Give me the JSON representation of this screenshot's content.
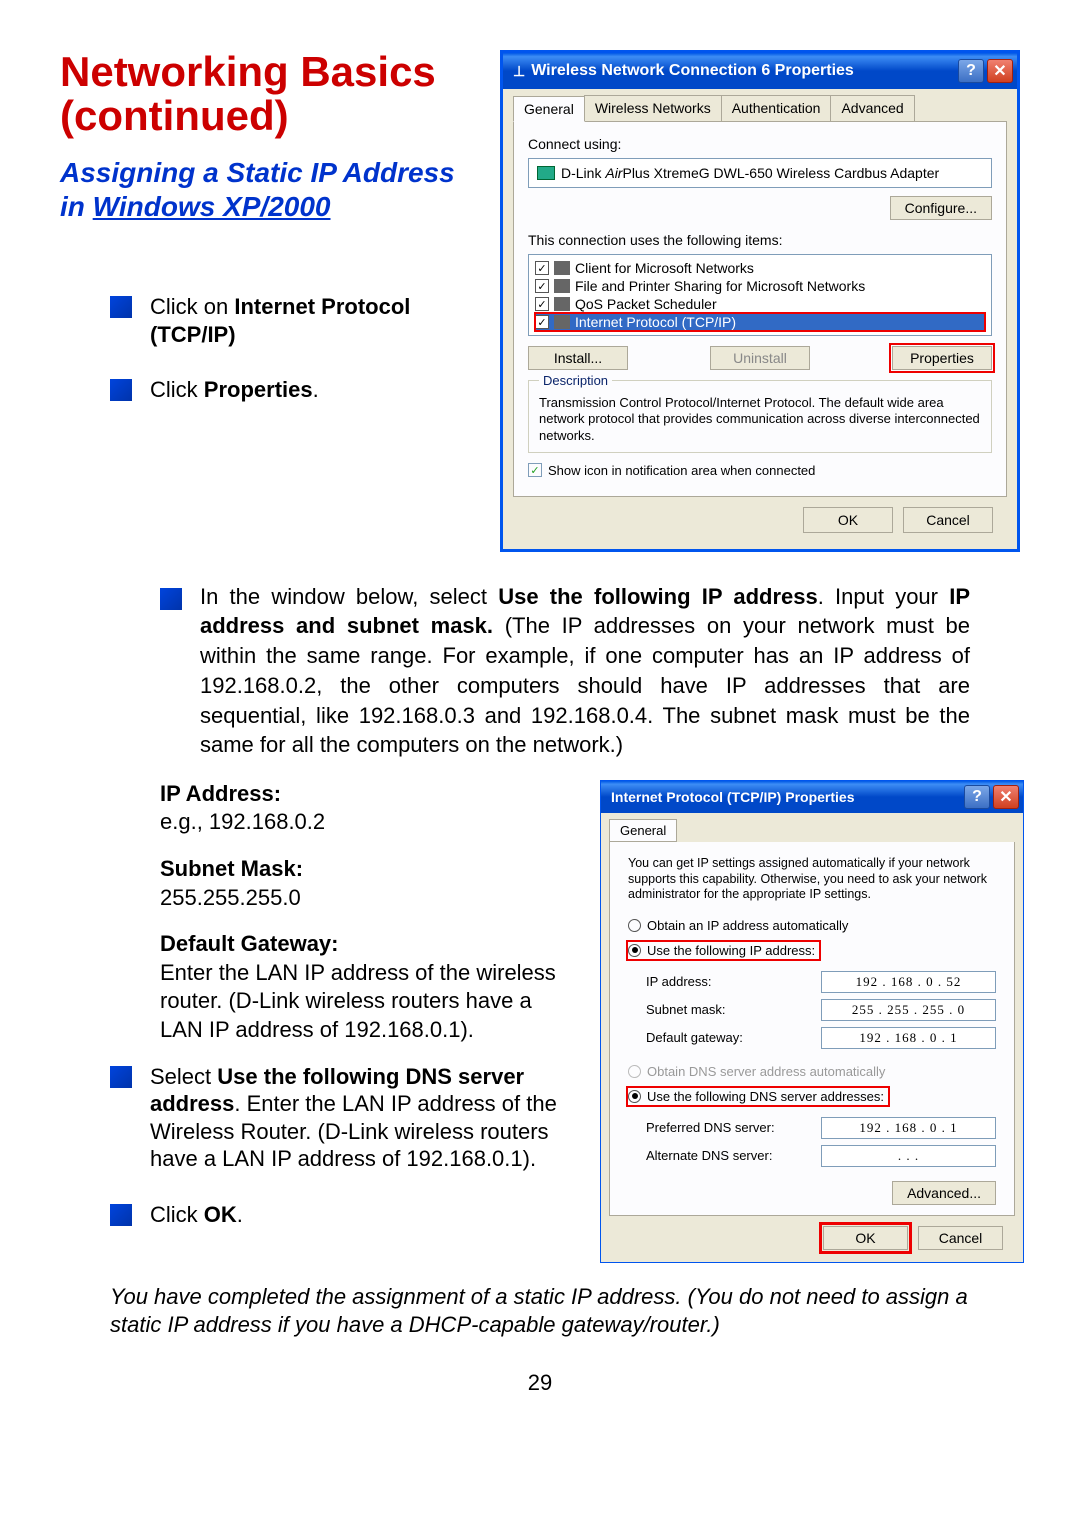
{
  "heading": "Networking Basics (continued)",
  "subheading": {
    "line1": "Assigning a Static IP Address",
    "line2_prefix": "in ",
    "line2_underlined": "Windows XP/2000"
  },
  "left_bullets": [
    {
      "pre": "Click on ",
      "bold": "Internet Protocol (TCP/IP)",
      "post": ""
    },
    {
      "pre": "Click ",
      "bold": "Properties",
      "post": "."
    }
  ],
  "dialog1": {
    "title": "Wireless Network Connection 6 Properties",
    "tabs": [
      "General",
      "Wireless Networks",
      "Authentication",
      "Advanced"
    ],
    "connect_using_label": "Connect using:",
    "adapter": "D-Link AirPlus XtremeG DWL-650 Wireless Cardbus Adapter",
    "configure_btn": "Configure...",
    "items_label": "This connection uses the following items:",
    "items": [
      {
        "label": "Client for Microsoft Networks",
        "checked": true,
        "selected": false
      },
      {
        "label": "File and Printer Sharing for Microsoft Networks",
        "checked": true,
        "selected": false
      },
      {
        "label": "QoS Packet Scheduler",
        "checked": true,
        "selected": false
      },
      {
        "label": "Internet Protocol (TCP/IP)",
        "checked": true,
        "selected": true
      }
    ],
    "install_btn": "Install...",
    "uninstall_btn": "Uninstall",
    "properties_btn": "Properties",
    "description_legend": "Description",
    "description_text": "Transmission Control Protocol/Internet Protocol. The default wide area network protocol that provides communication across diverse interconnected networks.",
    "show_icon_label": "Show icon in notification area when connected",
    "ok_btn": "OK",
    "cancel_btn": "Cancel"
  },
  "middle_bullet": {
    "parts": [
      {
        "t": "In the window below, select ",
        "b": false
      },
      {
        "t": "Use the following IP address",
        "b": true
      },
      {
        "t": ". Input your ",
        "b": false
      },
      {
        "t": "IP address and subnet mask.",
        "b": true
      },
      {
        "t": " (The IP addresses on your network must be within the same range. For example, if one computer has an IP address of 192.168.0.2, the other computers should have IP addresses that are sequential, like 192.168.0.3 and 192.168.0.4. The subnet mask must be the same for all the computers on the network.)",
        "b": false
      }
    ]
  },
  "definitions": {
    "ip_addr_label": "IP Address:",
    "ip_addr_val": "e.g., 192.168.0.2",
    "subnet_label": "Subnet Mask:",
    "subnet_val": "255.255.255.0",
    "gateway_label": "Default Gateway:",
    "gateway_val": "Enter the LAN IP address of the wireless router. (D-Link wireless routers have a LAN IP address of 192.168.0.1)."
  },
  "lower_bullets": [
    {
      "parts": [
        {
          "t": "Select ",
          "b": false
        },
        {
          "t": "Use the following DNS server address",
          "b": true
        },
        {
          "t": ". Enter the LAN IP address of the Wireless Router. (D-Link wireless routers have a LAN IP address of 192.168.0.1).",
          "b": false
        }
      ]
    },
    {
      "parts": [
        {
          "t": "Click ",
          "b": false
        },
        {
          "t": "OK",
          "b": true
        },
        {
          "t": ".",
          "b": false
        }
      ]
    }
  ],
  "dialog2": {
    "title": "Internet Protocol (TCP/IP) Properties",
    "tab": "General",
    "intro": "You can get IP settings assigned automatically if your network supports this capability. Otherwise, you need to ask your network administrator for the appropriate IP settings.",
    "radio_auto_ip": "Obtain an IP address automatically",
    "radio_use_ip": "Use the following IP address:",
    "ip_address_label": "IP address:",
    "ip_address_val": "192 . 168 .  0  .  52",
    "subnet_label": "Subnet mask:",
    "subnet_val": "255 . 255 . 255 .  0",
    "gateway_label": "Default gateway:",
    "gateway_val": "192 . 168 .  0  .  1",
    "radio_auto_dns": "Obtain DNS server address automatically",
    "radio_use_dns": "Use the following DNS server addresses:",
    "pref_dns_label": "Preferred DNS server:",
    "pref_dns_val": "192 . 168 .  0  .  1",
    "alt_dns_label": "Alternate DNS server:",
    "alt_dns_val": " .       .       .  ",
    "advanced_btn": "Advanced...",
    "ok_btn": "OK",
    "cancel_btn": "Cancel"
  },
  "closing_note": "You have completed the assignment of a static IP address. (You do not need to assign a static IP address if you have a DHCP-capable gateway/router.)",
  "page_number": "29"
}
